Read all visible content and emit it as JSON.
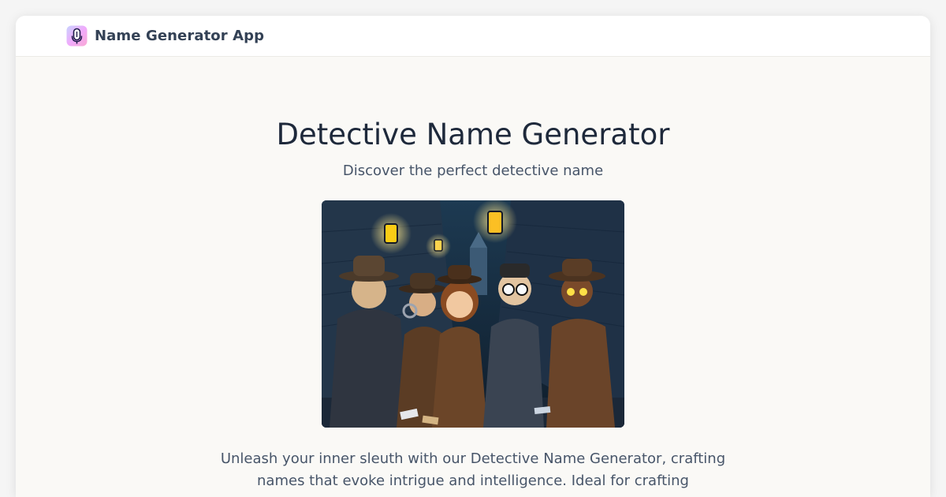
{
  "navbar": {
    "app_name": "Name Generator App",
    "logo_icon": "microphone-logo-icon"
  },
  "hero": {
    "title": "Detective Name Generator",
    "subtitle": "Discover the perfect detective name",
    "description": "Unleash your inner sleuth with our Detective Name Generator, crafting names that evoke intrigue and intelligence. Ideal for crafting"
  },
  "colors": {
    "page_background": "#faf9f6",
    "navbar_background": "#ffffff",
    "title_text": "#1e293b",
    "body_text": "#475569",
    "brand_text": "#334155"
  }
}
